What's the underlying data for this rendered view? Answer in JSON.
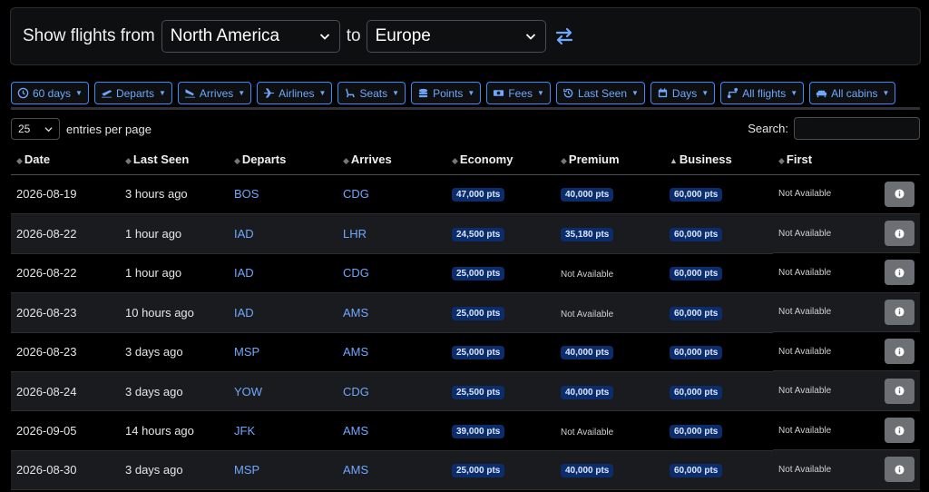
{
  "search_bar": {
    "show_label": "Show flights from",
    "from_value": "North America",
    "to_label": "to",
    "to_value": "Europe"
  },
  "filters": [
    {
      "label": "60 days",
      "icon": "clock-icon"
    },
    {
      "label": "Departs",
      "icon": "plane-departure-icon"
    },
    {
      "label": "Arrives",
      "icon": "plane-arrival-icon"
    },
    {
      "label": "Airlines",
      "icon": "plane-icon"
    },
    {
      "label": "Seats",
      "icon": "seat-icon"
    },
    {
      "label": "Points",
      "icon": "coins-icon"
    },
    {
      "label": "Fees",
      "icon": "money-icon"
    },
    {
      "label": "Last Seen",
      "icon": "history-icon"
    },
    {
      "label": "Days",
      "icon": "calendar-icon"
    },
    {
      "label": "All flights",
      "icon": "route-icon"
    },
    {
      "label": "All cabins",
      "icon": "couch-icon"
    }
  ],
  "entries": {
    "value": "25",
    "label": "entries per page"
  },
  "search": {
    "label": "Search:"
  },
  "table": {
    "columns": [
      "Date",
      "Last Seen",
      "Departs",
      "Arrives",
      "Economy",
      "Premium",
      "Business",
      "First"
    ],
    "rows": [
      {
        "date": "2026-08-19",
        "last_seen": "3 hours ago",
        "departs": "BOS",
        "arrives": "CDG",
        "economy": "47,000 pts",
        "premium": "40,000 pts",
        "business": "60,000 pts",
        "first": "Not Available"
      },
      {
        "date": "2026-08-22",
        "last_seen": "1 hour ago",
        "departs": "IAD",
        "arrives": "LHR",
        "economy": "24,500 pts",
        "premium": "35,180 pts",
        "business": "60,000 pts",
        "first": "Not Available"
      },
      {
        "date": "2026-08-22",
        "last_seen": "1 hour ago",
        "departs": "IAD",
        "arrives": "CDG",
        "economy": "25,000 pts",
        "premium": "Not Available",
        "business": "60,000 pts",
        "first": "Not Available"
      },
      {
        "date": "2026-08-23",
        "last_seen": "10 hours ago",
        "departs": "IAD",
        "arrives": "AMS",
        "economy": "25,000 pts",
        "premium": "Not Available",
        "business": "60,000 pts",
        "first": "Not Available"
      },
      {
        "date": "2026-08-23",
        "last_seen": "3 days ago",
        "departs": "MSP",
        "arrives": "AMS",
        "economy": "25,000 pts",
        "premium": "40,000 pts",
        "business": "60,000 pts",
        "first": "Not Available"
      },
      {
        "date": "2026-08-24",
        "last_seen": "3 days ago",
        "departs": "YOW",
        "arrives": "CDG",
        "economy": "25,500 pts",
        "premium": "40,000 pts",
        "business": "60,000 pts",
        "first": "Not Available"
      },
      {
        "date": "2026-09-05",
        "last_seen": "14 hours ago",
        "departs": "JFK",
        "arrives": "AMS",
        "economy": "39,000 pts",
        "premium": "Not Available",
        "business": "60,000 pts",
        "first": "Not Available"
      },
      {
        "date": "2026-08-30",
        "last_seen": "3 days ago",
        "departs": "MSP",
        "arrives": "AMS",
        "economy": "25,000 pts",
        "premium": "40,000 pts",
        "business": "60,000 pts",
        "first": "Not Available"
      }
    ]
  },
  "colors": {
    "accent": "#6ea8fe",
    "badge_bg": "#0c2d6b",
    "row_alt": "#1a1b1e"
  }
}
